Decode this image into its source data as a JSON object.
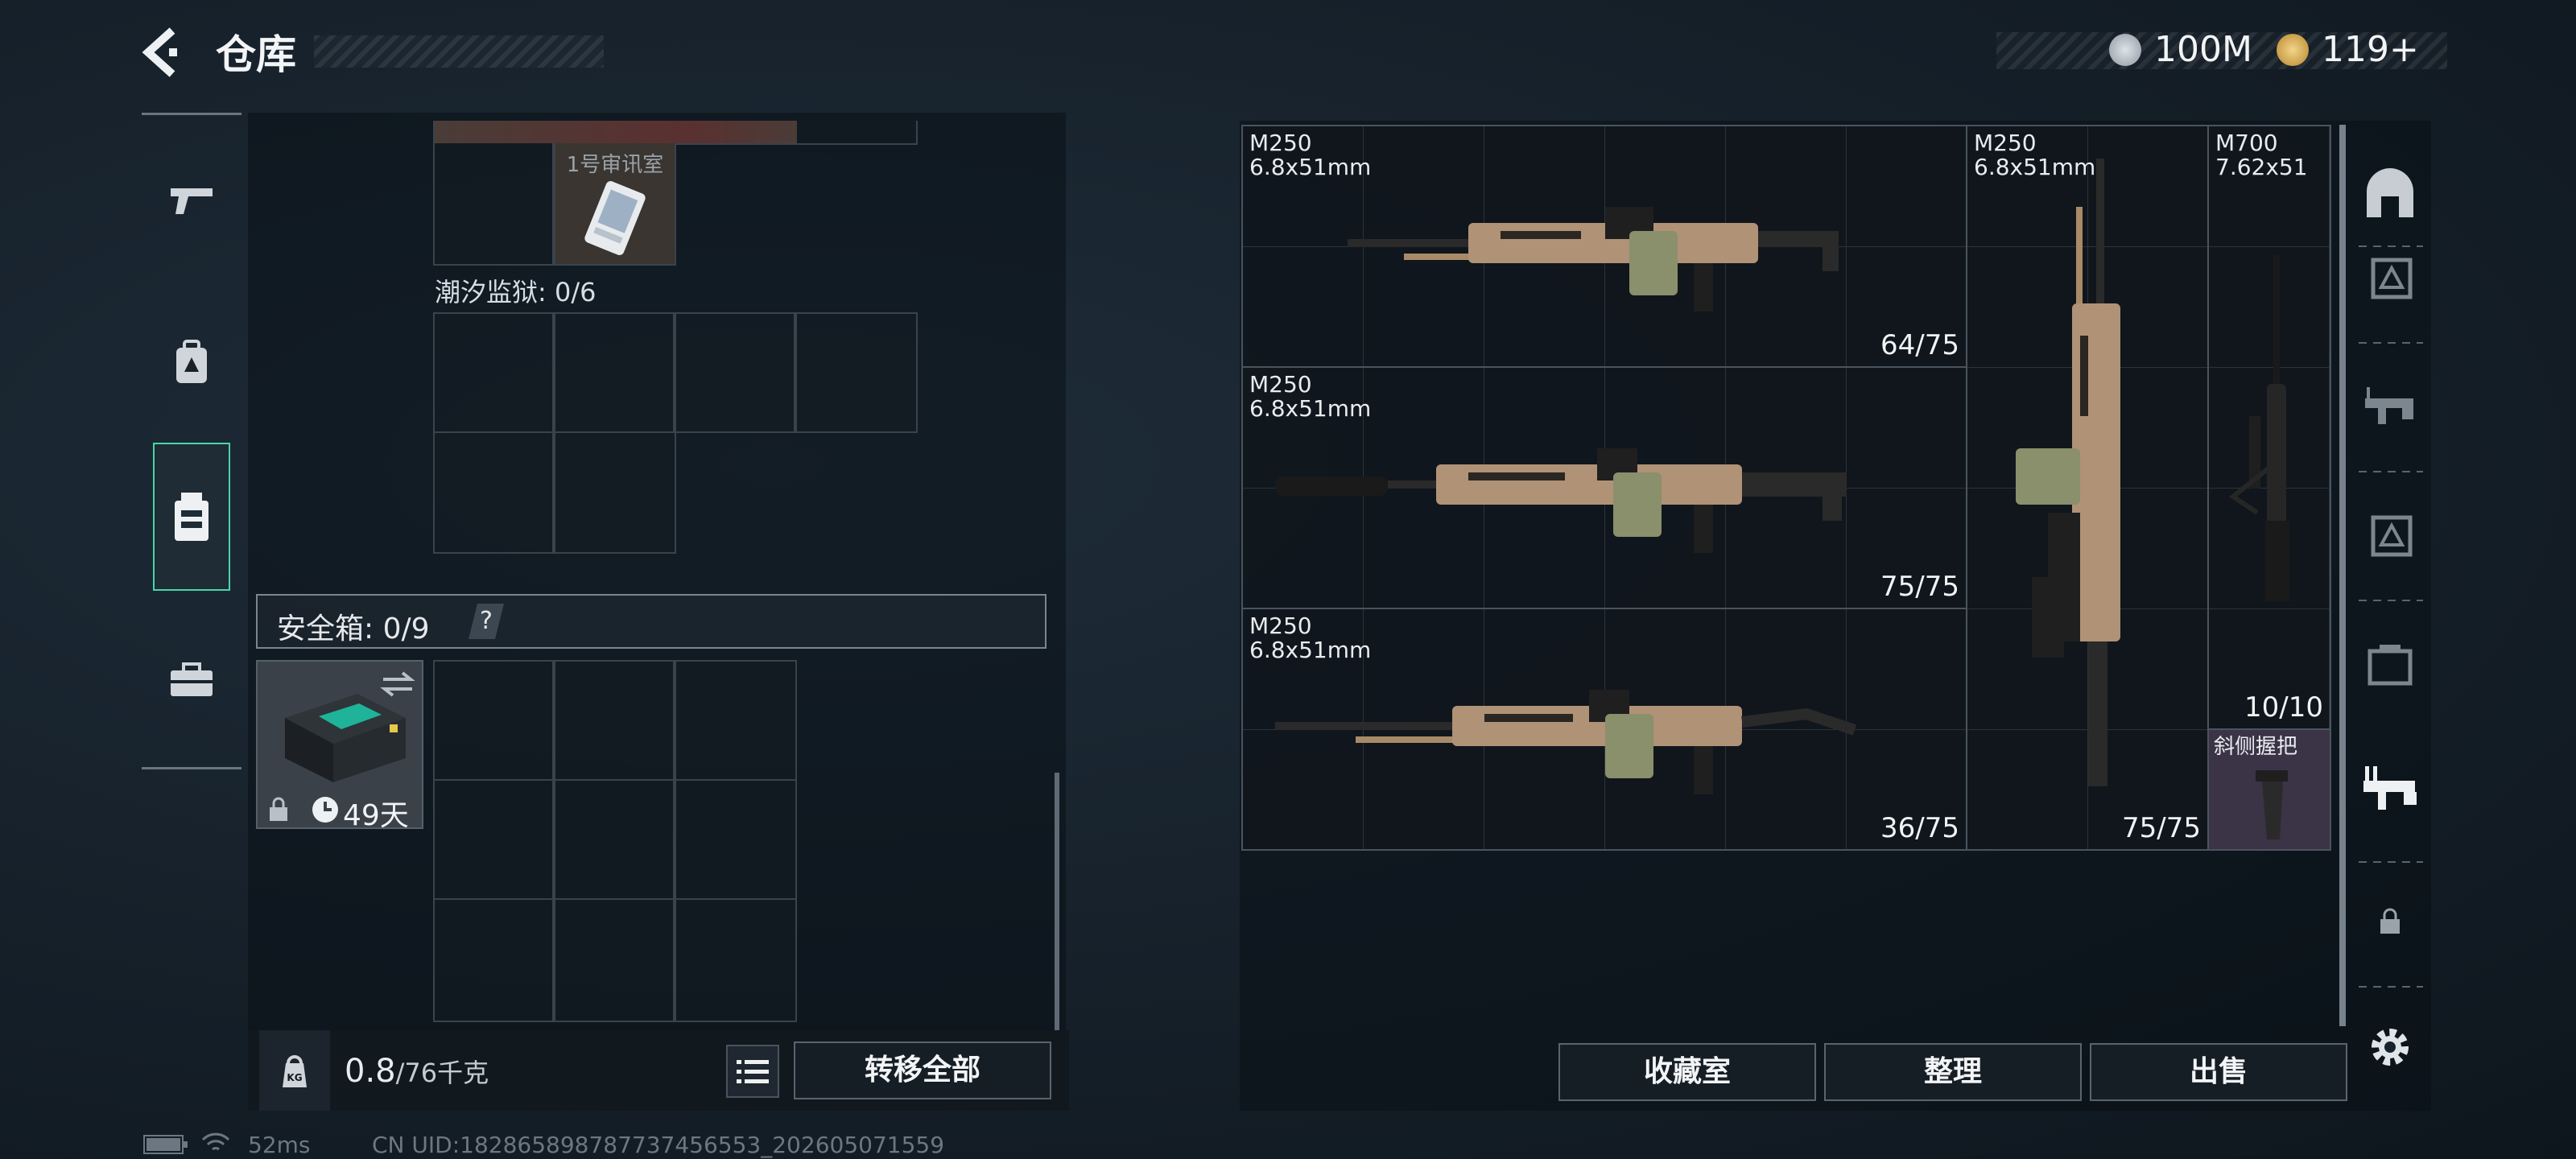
{
  "header": {
    "title": "仓库",
    "currency_1": "100M",
    "currency_2": "119+",
    "coin_colors": {
      "silver": "#b8c0c8",
      "gold": "#d9b25a"
    }
  },
  "left_rail": {
    "items": [
      {
        "icon": "pistol-icon",
        "active": false
      },
      {
        "icon": "backpack-icon",
        "active": false
      },
      {
        "icon": "vest-icon",
        "active": true
      },
      {
        "icon": "toolbox-icon",
        "active": false
      }
    ],
    "accent": "#4ad5a8"
  },
  "storage": {
    "item_label": "1号审讯室",
    "section_1_label": "潮汐监狱: 0/6",
    "safebox_label": "安全箱: 0/9",
    "safebox_help": "?",
    "safebox_timer": "49天",
    "weight_value": "0.8",
    "weight_max": "/76千克",
    "kg_icon_text": "KG",
    "transfer_all": "转移全部"
  },
  "grid_items": [
    {
      "name": "M250",
      "caliber": "6.8x51mm",
      "count": "64/75"
    },
    {
      "name": "M250",
      "caliber": "6.8x51mm",
      "count": "75/75"
    },
    {
      "name": "M250",
      "caliber": "6.8x51mm",
      "count": "36/75"
    },
    {
      "name": "M250",
      "caliber": "6.8x51mm",
      "count": "75/75"
    },
    {
      "name": "M700",
      "caliber": "7.62x51",
      "count": "10/10"
    },
    {
      "name": "斜侧握把",
      "caliber": "",
      "count": ""
    }
  ],
  "bottom_buttons": {
    "collection": "收藏室",
    "organize": "整理",
    "sell": "出售"
  },
  "right_rail": {
    "icons": [
      "safe-dome-icon",
      "armor-filter-icon",
      "weapon-filter-icon",
      "helmet-filter-icon",
      "case-filter-icon",
      "rifle-filter-icon",
      "lock-icon",
      "settings-gear-icon"
    ]
  },
  "footer": {
    "ping": "52ms",
    "uid": "CN UID:182865898787737456553_202605071559"
  }
}
